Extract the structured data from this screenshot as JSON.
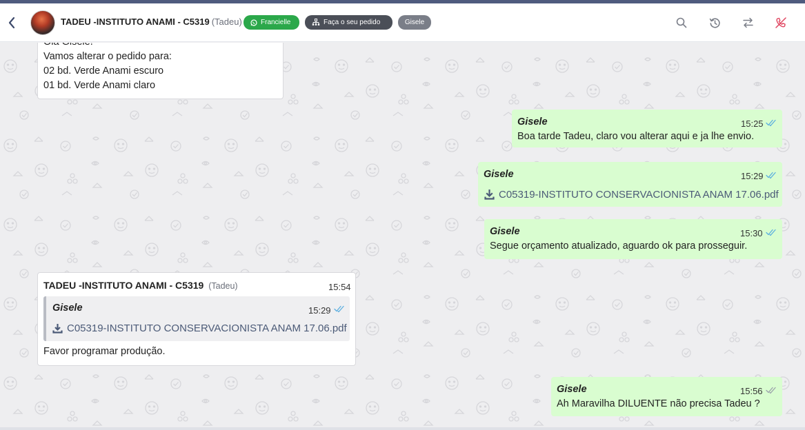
{
  "header": {
    "title": "TADEU -INSTITUTO ANAMI - C5319",
    "subtitle": "(Tadeu)",
    "tags": {
      "whatsapp": "Francielle",
      "order": "Faça o seu pedido",
      "user": "Gisele"
    }
  },
  "colors": {
    "outgoing_bubble": "#d9fdd0",
    "incoming_bubble": "#ffffff",
    "whatsapp_tag": "#2ba84a",
    "order_tag": "#4b4f58",
    "read_ticks": "#5aaee0",
    "end_call_icon": "#e04560"
  },
  "messages": {
    "m0": {
      "partial_line": "Olá Gisele!",
      "line1": "Vamos alterar o pedido para:",
      "line2": "02 bd. Verde Anami escuro",
      "line3": "01 bd. Verde Anami claro"
    },
    "m1": {
      "sender": "Gisele",
      "time": "15:25",
      "text": "Boa tarde Tadeu, claro vou alterar aqui e ja lhe envio."
    },
    "m2": {
      "sender": "Gisele",
      "time": "15:29",
      "file": "C05319-INSTITUTO CONSERVACIONISTA ANAM 17.06.pdf"
    },
    "m3": {
      "sender": "Gisele",
      "time": "15:30",
      "text": "Segue orçamento atualizado, aguardo ok para prosseguir."
    },
    "m4": {
      "sender": "TADEU -INSTITUTO ANAMI - C5319",
      "sender_sub": "(Tadeu)",
      "time": "15:54",
      "quote": {
        "sender": "Gisele",
        "time": "15:29",
        "file": "C05319-INSTITUTO CONSERVACIONISTA ANAM 17.06.pdf"
      },
      "text": "Favor programar produção."
    },
    "m5": {
      "sender": "Gisele",
      "time": "15:56",
      "text": "Ah Maravilha DILUENTE não precisa Tadeu ?"
    }
  }
}
